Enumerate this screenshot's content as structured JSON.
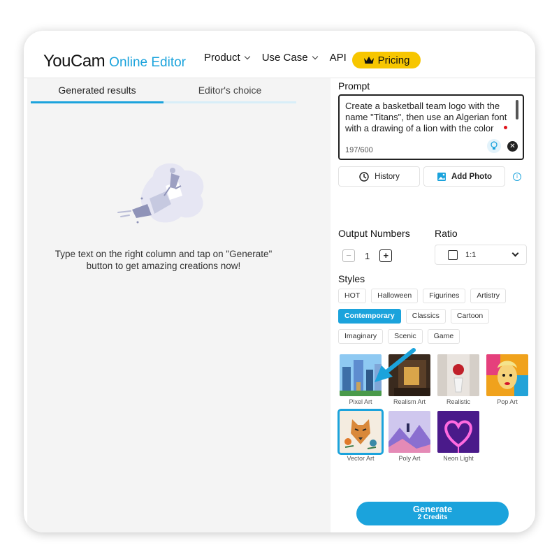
{
  "header": {
    "logo_main": "YouCam",
    "logo_sub": "Online Editor",
    "nav": [
      {
        "label": "Product",
        "has_dropdown": true
      },
      {
        "label": "Use Case",
        "has_dropdown": true
      },
      {
        "label": "API",
        "has_dropdown": false
      }
    ],
    "pricing_label": "Pricing"
  },
  "left_panel": {
    "tabs": [
      {
        "label": "Generated results",
        "active": true
      },
      {
        "label": "Editor's choice",
        "active": false
      }
    ],
    "empty_message": "Type text on the right column and tap on \"Generate\" button to get amazing creations now!"
  },
  "right_panel": {
    "prompt_label": "Prompt",
    "prompt_text": "Create a basketball team logo with the name \"Titans\", then use an Algerian font with a drawing of a lion with the color",
    "char_count": "197/600",
    "history_label": "History",
    "add_photo_label": "Add Photo",
    "output_numbers_label": "Output Numbers",
    "output_value": "1",
    "ratio_label": "Ratio",
    "ratio_value": "1:1",
    "styles_label": "Styles",
    "style_chips": [
      [
        "HOT",
        "Halloween",
        "Figurines",
        "Artistry"
      ],
      [
        "Contemporary",
        "Classics",
        "Cartoon"
      ],
      [
        "Imaginary",
        "Scenic",
        "Game"
      ]
    ],
    "active_chip": "Contemporary",
    "style_thumbs": [
      {
        "label": "Pixel Art"
      },
      {
        "label": "Realism Art"
      },
      {
        "label": "Realistic"
      },
      {
        "label": "Pop Art"
      },
      {
        "label": "Vector Art",
        "selected": true
      },
      {
        "label": "Poly Art"
      },
      {
        "label": "Neon Light"
      }
    ],
    "generate_label": "Generate",
    "generate_credits": "2 Credits"
  },
  "colors": {
    "accent": "#1ba3dc",
    "pricing": "#f7c600",
    "panel_bg": "#f4f4f4"
  }
}
